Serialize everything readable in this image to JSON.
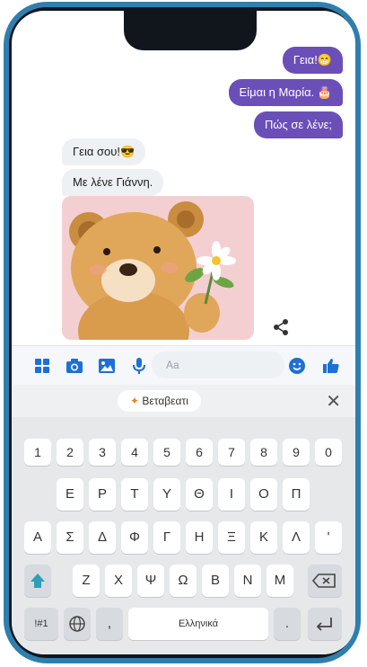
{
  "messages_sent": [
    {
      "text": "Γεια!",
      "emoji": "😁"
    },
    {
      "text": "Είμαι η Μαρία. ",
      "emoji": "🎂"
    },
    {
      "text": "Πώς σε λένε;",
      "emoji": ""
    }
  ],
  "messages_received": [
    {
      "text": "Γεια σου!",
      "emoji": "😎"
    },
    {
      "text": "Με λένε Γιάννη.",
      "emoji": ""
    }
  ],
  "composer": {
    "placeholder": "Aa"
  },
  "suggestion": {
    "label": "Βεταβεατι"
  },
  "keyboard": {
    "numbers": [
      "1",
      "2",
      "3",
      "4",
      "5",
      "6",
      "7",
      "8",
      "9",
      "0"
    ],
    "row1": [
      "Ε",
      "Ρ",
      "Τ",
      "Υ",
      "Θ",
      "Ι",
      "Ο",
      "Π"
    ],
    "row2": [
      "Α",
      "Σ",
      "Δ",
      "Φ",
      "Γ",
      "Η",
      "Ξ",
      "Κ",
      "Λ",
      "'"
    ],
    "row3": [
      "Ζ",
      "Χ",
      "Ψ",
      "Ω",
      "Β",
      "Ν",
      "Μ"
    ],
    "symbols_key": "!#1",
    "comma": ",",
    "space": "Ελληνικά",
    "period": "."
  },
  "colors": {
    "accent": "#6b4fb8",
    "icons": "#1e6fd6",
    "frame": "#2f7fae"
  }
}
